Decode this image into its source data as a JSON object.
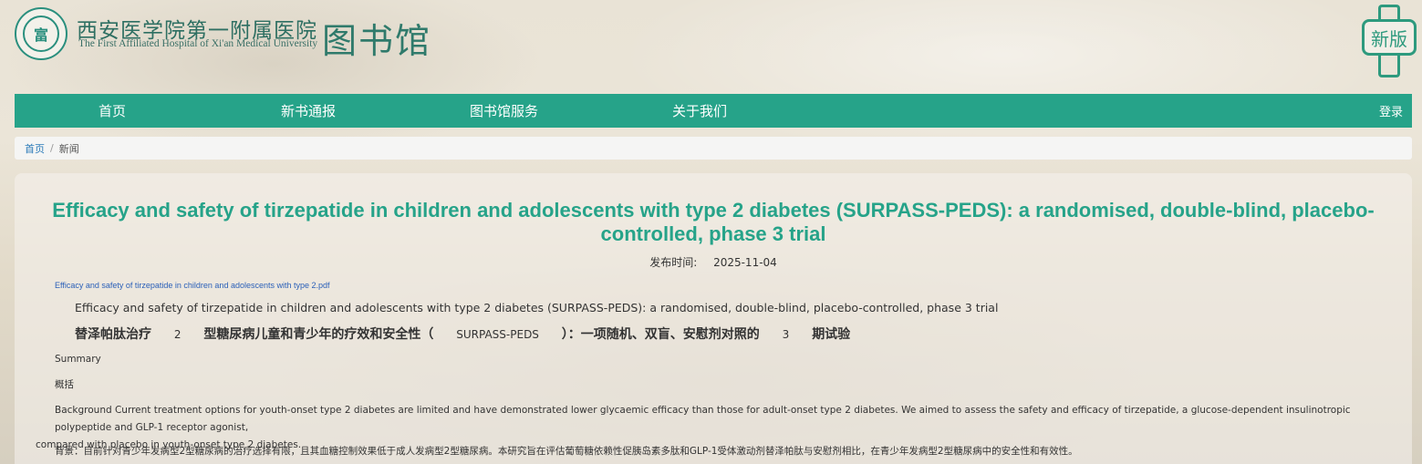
{
  "header": {
    "hospital_name_cn": "西安医学院第一附属医院",
    "hospital_name_en": "The First Affiliated Hospital of Xi'an Medical University",
    "library_title": "图书馆",
    "seal_glyph": "富",
    "new_version_label": "新版"
  },
  "nav": {
    "items": [
      {
        "label": "首页"
      },
      {
        "label": "新书通报"
      },
      {
        "label": "图书馆服务"
      },
      {
        "label": "关于我们"
      }
    ],
    "login": "登录"
  },
  "breadcrumb": {
    "home": "首页",
    "separator": "/",
    "current": "新闻"
  },
  "article": {
    "title": "Efficacy and safety of tirzepatide in children and adolescents with type 2 diabetes (SURPASS-PEDS): a randomised, double-blind, placebo-controlled, phase 3 trial",
    "publish_label": "发布时间:",
    "publish_date": "2025-11-04",
    "pdf_link": "Efficacy and safety of tirzepatide in children and adolescents with type 2.pdf",
    "en_subtitle": "Efficacy and safety of tirzepatide in children and adolescents with type 2 diabetes (SURPASS-PEDS): a randomised, double-blind, placebo-controlled, phase 3 trial",
    "cn_subtitle_parts": [
      "替泽帕肽治疗",
      "2",
      "型糖尿病儿童和青少年的疗效和安全性（",
      "SURPASS-PEDS",
      "）：一项随机、双盲、安慰剂对照的",
      "3",
      "期试验"
    ],
    "summary_en": "Summary",
    "summary_cn": "概括",
    "background_en_line1": "Background Current treatment options for youth-onset type 2 diabetes are limited and have demonstrated lower glycaemic efficacy than those for adult-onset type 2 diabetes. We aimed to assess the safety and efficacy of tirzepatide, a glucose-dependent insulinotropic polypeptide and GLP-1 receptor agonist,",
    "background_en_line2": "compared with placebo in youth-onset type 2 diabetes.",
    "background_cn": "背景：目前针对青少年发病型2型糖尿病的治疗选择有限，且其血糖控制效果低于成人发病型2型糖尿病。本研究旨在评估葡萄糖依赖性促胰岛素多肽和GLP-1受体激动剂替泽帕肽与安慰剂相比，在青少年发病型2型糖尿病中的安全性和有效性。"
  },
  "colors": {
    "brand_green": "#26a389",
    "link_blue": "#2a5fb8"
  }
}
